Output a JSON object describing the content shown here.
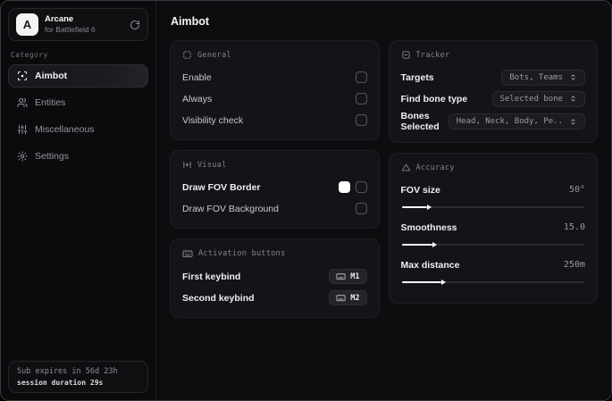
{
  "sidebar": {
    "logo_letter": "A",
    "app_name": "Arcane",
    "app_subtitle": "for Battlefield 6",
    "category_label": "Category",
    "items": [
      {
        "label": "Aimbot",
        "icon": "crosshair-scan-icon",
        "selected": true
      },
      {
        "label": "Entities",
        "icon": "users-icon",
        "selected": false
      },
      {
        "label": "Miscellaneous",
        "icon": "sliders-vertical-icon",
        "selected": false
      },
      {
        "label": "Settings",
        "icon": "gear-icon",
        "selected": false
      }
    ],
    "footer": {
      "line1": "Sub expires in 56d 23h",
      "line2": "session duration 29s"
    }
  },
  "main": {
    "title": "Aimbot",
    "cards": {
      "general": {
        "title": "General",
        "rows": [
          {
            "label": "Enable",
            "checked": false
          },
          {
            "label": "Always",
            "checked": false
          },
          {
            "label": "Visibility check",
            "checked": false
          }
        ]
      },
      "visual": {
        "title": "Visual",
        "rows": [
          {
            "label": "Draw FOV Border",
            "swatch_color": "#ffffff",
            "checked": false
          },
          {
            "label": "Draw FOV Background",
            "checked": false
          }
        ]
      },
      "activation": {
        "title": "Activation buttons",
        "rows": [
          {
            "label": "First keybind",
            "key": "M1"
          },
          {
            "label": "Second keybind",
            "key": "M2"
          }
        ]
      },
      "tracker": {
        "title": "Tracker",
        "rows": [
          {
            "label": "Targets",
            "value": "Bots, Teams"
          },
          {
            "label": "Find bone type",
            "value": "Selected bone"
          },
          {
            "label": "Bones Selected",
            "value": "Head, Neck, Body, Pe.."
          }
        ]
      },
      "accuracy": {
        "title": "Accuracy",
        "sliders": [
          {
            "label": "FOV size",
            "value": "50°",
            "fill": "14%"
          },
          {
            "label": "Smoothness",
            "value": "15.0",
            "fill": "17%"
          },
          {
            "label": "Max distance",
            "value": "250m",
            "fill": "22%"
          }
        ]
      }
    }
  },
  "colors": {
    "window_bg": "#0c0c0e",
    "card_bg": "#141418",
    "accent": "#ffffff",
    "fov_border_swatch": "#ffffff",
    "muted_text": "#83838b"
  }
}
